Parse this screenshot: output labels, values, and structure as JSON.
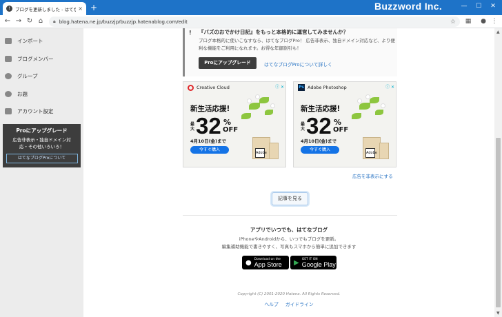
{
  "browser": {
    "tab_title": "ブログを更新しました - はてなブログ",
    "tab_close": "×",
    "new_tab": "+",
    "brand": "Buzzword Inc.",
    "url": "blog.hatena.ne.jp/buzzjp/buzzjp.hatenablog.com/edit",
    "minimize": "—",
    "maximize": "☐",
    "close": "✕"
  },
  "sidebar": {
    "items": [
      {
        "label": "インポート",
        "icon": "truck-icon"
      },
      {
        "label": "ブログメンバー",
        "icon": "id-card-icon"
      },
      {
        "label": "グループ",
        "icon": "users-icon"
      },
      {
        "label": "お題",
        "icon": "speech-bubble-icon"
      },
      {
        "label": "アカウント設定",
        "icon": "person-icon"
      }
    ],
    "pro_box": {
      "title": "Proにアップグレード",
      "line1": "広告非表示・独自ドメイン対",
      "line2": "応・その他いろいろ！",
      "link": "はてなブログProについて"
    }
  },
  "notice": {
    "icon": "!",
    "title": "『バズのおでかけ日記』をもっと本格的に運営してみませんか？",
    "body": "ブログ本格的に使いこなすなら、はてなブログPro！ 広告非表示、独自ドメイン対応など、より便利な機能をご利用になれます。お得な年額割引も！",
    "button": "Proにアップグレード",
    "link": "はてなブログProについて詳しく"
  },
  "ads": [
    {
      "brand": "Creative Cloud",
      "badge": "ⓘ ✕",
      "headline": "新生活応援!",
      "lead": "最大",
      "percent": "32",
      "percent_sign": "%",
      "off": "OFF",
      "date": "4月10日(金)まで",
      "cta": "今すぐ購入",
      "logo": "Adobe"
    },
    {
      "brand": "Adobe Photoshop",
      "badge": "ⓘ ✕",
      "headline": "新生活応援!",
      "lead": "最大",
      "percent": "32",
      "percent_sign": "%",
      "off": "OFF",
      "date": "4月10日(金)まで",
      "cta": "今すぐ購入",
      "logo": "Adobe"
    }
  ],
  "ad_hide": "広告を非表示にする",
  "read_button": "記事を見る",
  "app": {
    "title": "アプリでいつでも、はてなブログ",
    "desc1": "iPhoneやAndroidから、いつでもブログを更新。",
    "desc2": "編集補助機能で書きやすく、写真もスマホから簡単に追加できます",
    "appstore_small": "Download on the",
    "appstore_big": "App Store",
    "googleplay_small": "GET IT ON",
    "googleplay_big": "Google Play"
  },
  "footer": {
    "copyright": "Copyright (C) 2001-2020 Hatena. All Rights Reserved.",
    "help": "ヘルプ",
    "guide": "ガイドライン"
  }
}
